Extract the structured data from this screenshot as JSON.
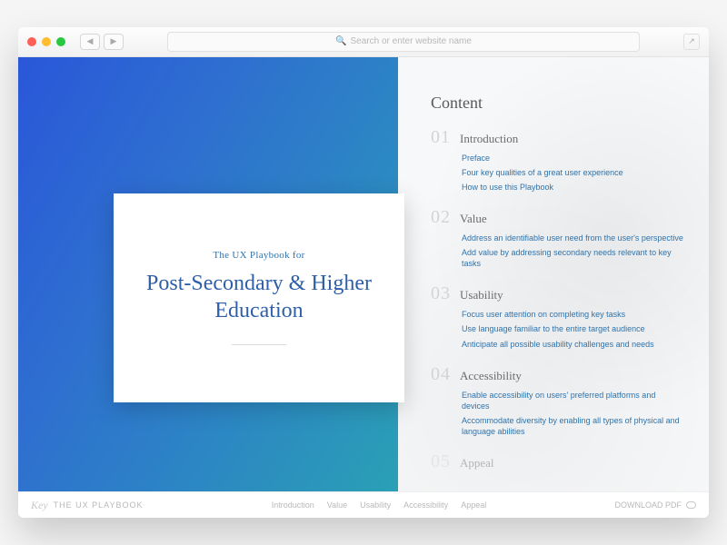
{
  "browser": {
    "url_placeholder": "Search or enter website name"
  },
  "hero": {
    "eyebrow": "The UX Playbook for",
    "headline": "Post-Secondary & Higher Education"
  },
  "toc": {
    "heading": "Content",
    "sections": [
      {
        "num": "01",
        "title": "Introduction",
        "links": [
          "Preface",
          "Four key qualities of a great user experience",
          "How to use this Playbook"
        ]
      },
      {
        "num": "02",
        "title": "Value",
        "links": [
          "Address an identifiable user need from the user's perspective",
          "Add value by addressing secondary needs relevant to key tasks"
        ]
      },
      {
        "num": "03",
        "title": "Usability",
        "links": [
          "Focus user attention on completing key tasks",
          "Use language familiar to the entire target audience",
          "Anticipate all possible usability challenges and needs"
        ]
      },
      {
        "num": "04",
        "title": "Accessibility",
        "links": [
          "Enable accessibility on users' preferred platforms and devices",
          "Accommodate diversity by enabling all types of physical and language abilities"
        ]
      },
      {
        "num": "05",
        "title": "Appeal",
        "links": []
      }
    ]
  },
  "footer": {
    "brand": "Key",
    "name": "THE UX PLAYBOOK",
    "nav": [
      "Introduction",
      "Value",
      "Usability",
      "Accessibility",
      "Appeal"
    ],
    "download": "DOWNLOAD PDF"
  }
}
